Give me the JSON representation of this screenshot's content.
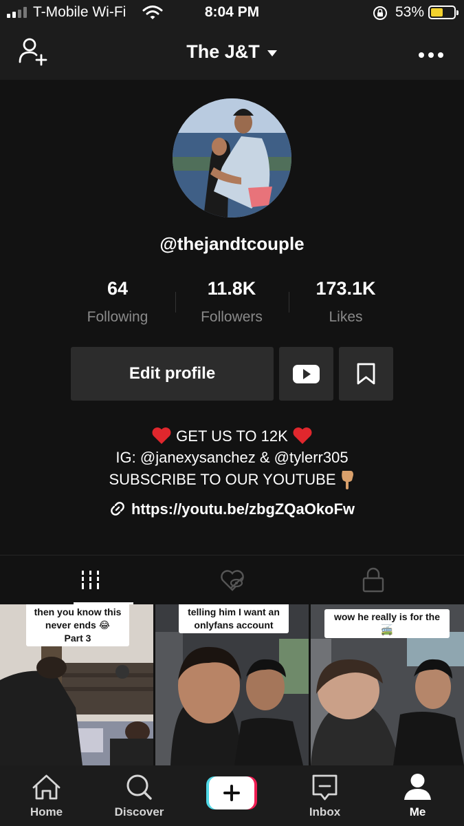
{
  "status_bar": {
    "carrier": "T-Mobile Wi-Fi",
    "time": "8:04 PM",
    "battery": "53%",
    "battery_level": 0.53,
    "icons": [
      "signal-icon",
      "wifi-icon",
      "rotation-lock-icon",
      "battery-icon"
    ]
  },
  "header": {
    "title": "The J&T",
    "icons": [
      "add-user-icon",
      "chevron-down-icon",
      "more-icon"
    ]
  },
  "profile": {
    "username": "@thejandtcouple",
    "stats": [
      {
        "value": "64",
        "label": "Following"
      },
      {
        "value": "11.8K",
        "label": "Followers"
      },
      {
        "value": "173.1K",
        "label": "Likes"
      }
    ],
    "edit_label": "Edit profile",
    "bio": {
      "line1": "GET US TO 12K",
      "line2": "IG: @janexysanchez & @tylerr305",
      "line3": "SUBSCRIBE TO OUR YOUTUBE"
    },
    "link": "https://youtu.be/zbgZQaOkoFw"
  },
  "tabs": [
    "videos-grid-icon",
    "liked-private-icon",
    "lock-icon"
  ],
  "videos": [
    {
      "caption_line1": "then you know this",
      "caption_line2": "never ends 😂",
      "caption_line3": "Part 3"
    },
    {
      "caption_line1": "telling him I want an",
      "caption_line2": "onlyfans account"
    },
    {
      "caption_line1": "wow he really is for the",
      "caption_line2": "🚎"
    }
  ],
  "nav": {
    "home": "Home",
    "discover": "Discover",
    "inbox": "Inbox",
    "me": "Me"
  },
  "colors": {
    "background": "#121212",
    "bar": "#1c1c1c",
    "button": "#2c2c2c",
    "muted_text": "#8a8a8a",
    "battery": "#f2d22e",
    "accent_cyan": "#4fd8e6",
    "accent_red": "#ee1d52",
    "heart_red": "#e0272d"
  }
}
